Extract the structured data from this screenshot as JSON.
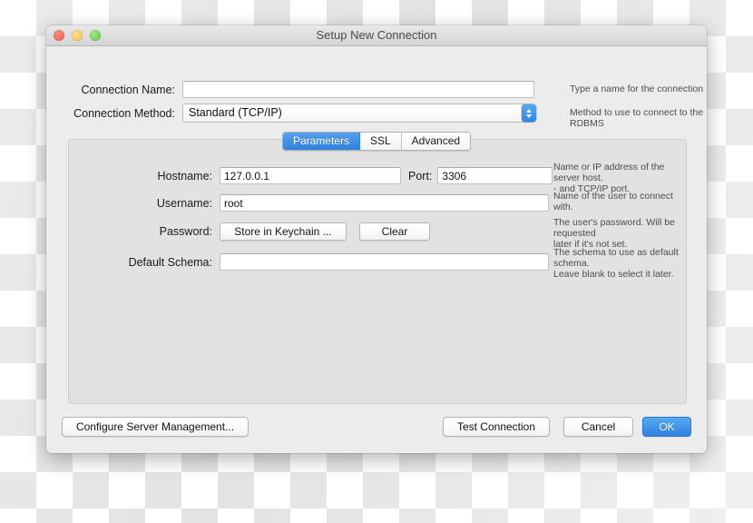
{
  "window": {
    "title": "Setup New Connection",
    "traffic_lights": [
      "close-button",
      "minimize-button",
      "zoom-button"
    ]
  },
  "form": {
    "connection_name": {
      "label": "Connection Name:",
      "value": "",
      "placeholder": "",
      "hint": "Type a name for the connection"
    },
    "connection_method": {
      "label": "Connection Method:",
      "value": "Standard (TCP/IP)",
      "hint": "Method to use to connect to the RDBMS",
      "options": [
        "Standard (TCP/IP)"
      ]
    }
  },
  "tabs": [
    {
      "label": "Parameters",
      "active": true
    },
    {
      "label": "SSL",
      "active": false
    },
    {
      "label": "Advanced",
      "active": false
    }
  ],
  "parameters": {
    "hostname": {
      "label": "Hostname:",
      "value": "127.0.0.1",
      "hint": "Name or IP address of the server host.\n - and TCP/IP port."
    },
    "port": {
      "label": "Port:",
      "value": "3306"
    },
    "username": {
      "label": "Username:",
      "value": "root",
      "hint": "Name of the user to connect with."
    },
    "password": {
      "label": "Password:",
      "store_button": "Store in Keychain ...",
      "clear_button": "Clear",
      "hint": "The user's password. Will be requested\nlater if it's not set."
    },
    "default_schema": {
      "label": "Default Schema:",
      "value": "",
      "placeholder": "",
      "hint": "The schema to use as default schema.\nLeave blank to select it later."
    }
  },
  "footer": {
    "configure_server": "Configure Server Management...",
    "test_connection": "Test Connection",
    "cancel": "Cancel",
    "ok": "OK"
  },
  "colors": {
    "accent_blue": "#2f82e2",
    "window_bg": "#ececec",
    "panel_bg": "#e2e2e2"
  }
}
